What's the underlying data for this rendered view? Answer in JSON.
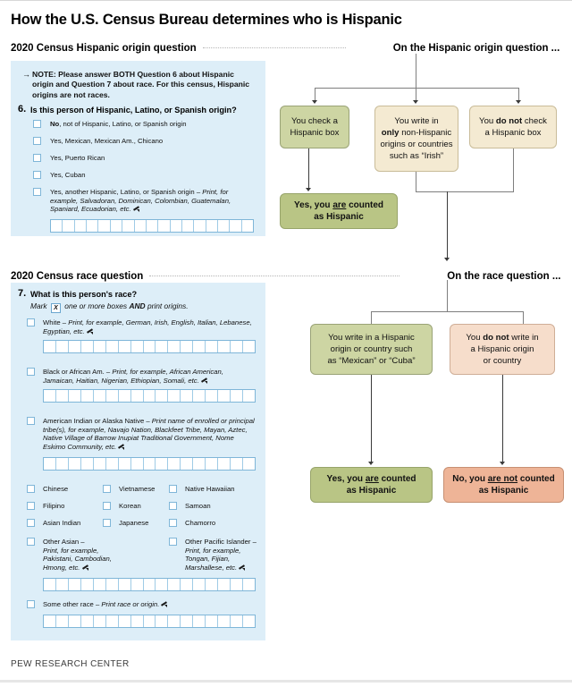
{
  "title": "How the U.S. Census Bureau determines who is Hispanic",
  "footer": "PEW RESEARCH CENTER",
  "sections": {
    "hispanic": {
      "left_label": "2020 Census Hispanic origin question",
      "right_label": "On the Hispanic origin question ...",
      "note": "NOTE: Please answer BOTH Question 6 about Hispanic origin and Question 7 about race. For this census, Hispanic origins are not races.",
      "note_arrow": "→",
      "question_number": "6.",
      "question_text": "Is this person of Hispanic, Latino, or Spanish origin?",
      "options": [
        {
          "bold": "No",
          "rest": ", not of Hispanic, Latino, or Spanish origin"
        },
        {
          "bold": "",
          "rest": "Yes, Mexican, Mexican Am., Chicano"
        },
        {
          "bold": "",
          "rest": "Yes, Puerto Rican"
        },
        {
          "bold": "",
          "rest": "Yes, Cuban"
        },
        {
          "bold": "",
          "rest": "Yes, another Hispanic, Latino, or Spanish origin – "
        }
      ],
      "write_in_hint": "Print, for example, Salvadoran, Dominican, Colombian, Guatemalan, Spaniard, Ecuadorian, etc.",
      "write_in_cells": 17
    },
    "race": {
      "left_label": "2020 Census race question",
      "right_label": "On the race question ...",
      "question_number": "7.",
      "question_text": "What is this person's race?",
      "instruction_pre": "Mark",
      "instruction_mark": "X",
      "instruction_post_a": "one or more boxes",
      "instruction_and": "AND",
      "instruction_post_b": "print origins.",
      "groups": [
        {
          "label": "White – ",
          "hint": "Print, for example, German, Irish, English, Italian, Lebanese, Egyptian, etc.",
          "cells": 17
        },
        {
          "label": "Black or African Am. – ",
          "hint": "Print, for example, African American, Jamaican, Haitian, Nigerian, Ethiopian, Somali, etc.",
          "cells": 17
        },
        {
          "label": "American Indian or Alaska Native – ",
          "hint": "Print name of enrolled or principal tribe(s), for example, Navajo Nation, Blackfeet Tribe, Mayan, Aztec, Native Village of Barrow Inupiat Traditional Government, Nome Eskimo Community, etc.",
          "cells": 17
        }
      ],
      "columns": [
        [
          "Chinese",
          "Filipino",
          "Asian Indian"
        ],
        [
          "Vietnamese",
          "Korean",
          "Japanese"
        ],
        [
          "Native Hawaiian",
          "Samoan",
          "Chamorro"
        ]
      ],
      "other_asian": {
        "label": "Other Asian –",
        "hint": "Print, for example, Pakistani, Cambodian, Hmong, etc."
      },
      "other_pacific": {
        "label": "Other Pacific Islander –",
        "hint": "Print, for example, Tongan, Fijian, Marshallese, etc."
      },
      "other_cells": 17,
      "some_other_race": {
        "label": "Some other race – ",
        "hint": "Print race or origin.",
        "cells": 17
      }
    }
  },
  "flow": {
    "hispanic_boxes": [
      {
        "id": "check-hispanic-box",
        "color": "green",
        "parts": [
          {
            "t": "You check a",
            "s": "n"
          },
          {
            "t": "Hispanic box",
            "s": "n"
          }
        ]
      },
      {
        "id": "write-non-hispanic",
        "color": "cream",
        "line1_a": "You write in",
        "line2_b": "only",
        "line2_a": " non-Hispanic",
        "line3": "origins or countries",
        "line4": "such as “Irish”"
      },
      {
        "id": "do-not-check",
        "color": "cream",
        "pre": "You ",
        "bold": "do not",
        "post": " check",
        "line2": "a Hispanic box"
      }
    ],
    "hispanic_result": {
      "pre": "Yes, you ",
      "u": "are",
      "post": " counted",
      "line2": "as Hispanic"
    },
    "race_boxes": [
      {
        "id": "write-hispanic-origin",
        "color": "green",
        "line1": "You write in a Hispanic",
        "line2": "origin or country such",
        "line3": "as “Mexican” or “Cuba”"
      },
      {
        "id": "no-hispanic-origin",
        "color": "peach",
        "pre": "You ",
        "bold": "do not",
        "post": " write in",
        "line2": "a Hispanic origin",
        "line3": "or country"
      }
    ],
    "race_results": [
      {
        "id": "counted-hispanic",
        "color": "res-green",
        "pre": "Yes, you ",
        "u": "are",
        "post": " counted",
        "line2": "as Hispanic"
      },
      {
        "id": "not-counted-hispanic",
        "color": "res-peach",
        "pre": "No, you ",
        "u": "are not",
        "post": " counted",
        "line2": "as Hispanic"
      }
    ]
  },
  "colors": {
    "panel_bg": "#ddeef8",
    "green": "#cdd5a3",
    "cream": "#f4ead2",
    "peach": "#f6ddcb",
    "result_green": "#b9c585",
    "result_peach": "#eeb497"
  }
}
